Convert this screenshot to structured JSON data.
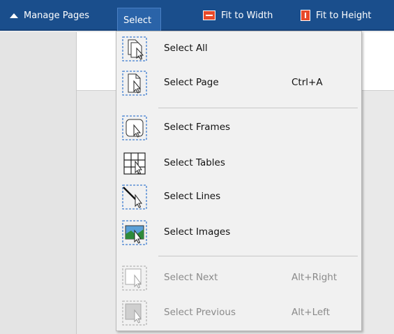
{
  "toolbar": {
    "manage_pages": "Manage Pages",
    "select": "Select",
    "fit_to_width": "Fit to Width",
    "fit_to_height": "Fit to Height"
  },
  "menu": {
    "items": [
      {
        "label": "Select All",
        "shortcut": "",
        "icon": "select-all-icon",
        "enabled": true
      },
      {
        "label": "Select Page",
        "shortcut": "Ctrl+A",
        "icon": "select-page-icon",
        "enabled": true
      },
      {
        "label": "Select Frames",
        "shortcut": "",
        "icon": "select-frames-icon",
        "enabled": true
      },
      {
        "label": "Select Tables",
        "shortcut": "",
        "icon": "select-tables-icon",
        "enabled": true
      },
      {
        "label": "Select Lines",
        "shortcut": "",
        "icon": "select-lines-icon",
        "enabled": true
      },
      {
        "label": "Select Images",
        "shortcut": "",
        "icon": "select-images-icon",
        "enabled": true
      },
      {
        "label": "Select Next",
        "shortcut": "Alt+Right",
        "icon": "select-next-icon",
        "enabled": false
      },
      {
        "label": "Select Previous",
        "shortcut": "Alt+Left",
        "icon": "select-previous-icon",
        "enabled": false
      }
    ]
  },
  "colors": {
    "toolbar_bg": "#1a4e8c",
    "accent_dash": "#3f7ed0",
    "menu_bg": "#f1f1f1",
    "disabled_text": "#8a8a8a"
  }
}
